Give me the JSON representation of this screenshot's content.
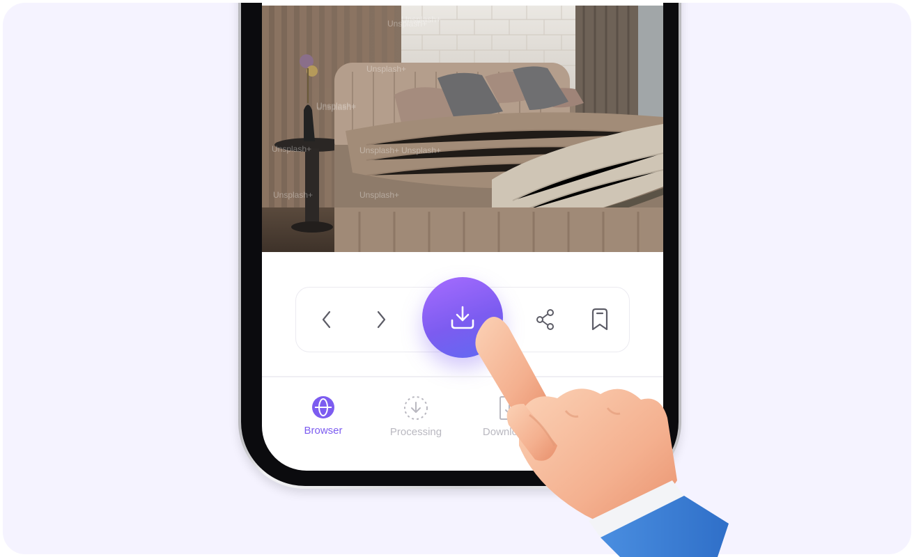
{
  "photo": {
    "watermark": "Unsplash+"
  },
  "toolbar": {
    "back_icon": "chevron-left-icon",
    "forward_icon": "chevron-right-icon",
    "download_icon": "download-icon",
    "share_icon": "share-icon",
    "bookmark_icon": "bookmark-icon"
  },
  "bottom_nav": {
    "items": [
      {
        "label": "Browser",
        "icon": "globe-icon",
        "active": true
      },
      {
        "label": "Processing",
        "icon": "processing-icon",
        "active": false
      },
      {
        "label": "Downloads",
        "icon": "file-download-icon",
        "active": false
      }
    ]
  },
  "colors": {
    "accent": "#7c5cf0",
    "background": "#f5f3ff",
    "inactive": "#b9b8c0"
  }
}
